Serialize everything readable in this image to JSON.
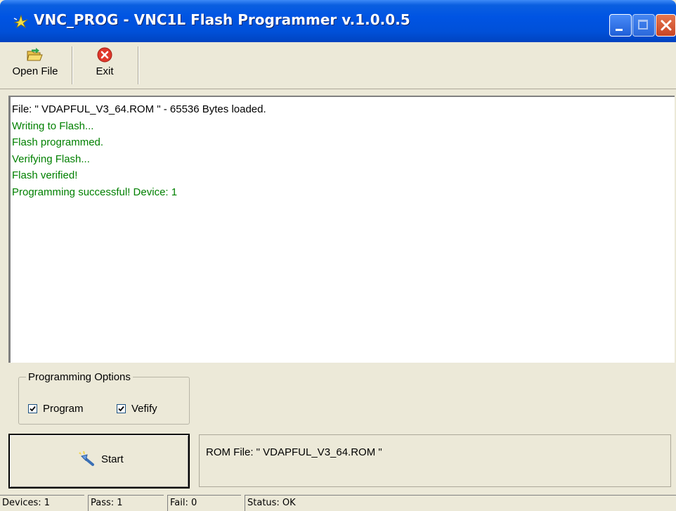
{
  "window": {
    "title": "VNC_PROG - VNC1L Flash Programmer v.1.0.0.5",
    "icons": {
      "app": "sparkle-icon",
      "minimize": "minimize-icon",
      "maximize": "maximize-icon",
      "close": "close-icon"
    }
  },
  "toolbar": {
    "open_file": {
      "label": "Open File",
      "icon": "folder-open-icon"
    },
    "exit": {
      "label": "Exit",
      "icon": "error-circle-icon"
    }
  },
  "log": {
    "lines": [
      {
        "text": "File: \" VDAPFUL_V3_64.ROM \" - 65536 Bytes loaded.",
        "color": "#000000"
      },
      {
        "text": "Writing to Flash...",
        "color": "#008000"
      },
      {
        "text": "Flash programmed.",
        "color": "#008000"
      },
      {
        "text": "Verifying Flash...",
        "color": "#008000"
      },
      {
        "text": "Flash verified!",
        "color": "#008000"
      },
      {
        "text": "Programming successful! Device: 1",
        "color": "#008000"
      }
    ]
  },
  "options": {
    "legend": "Programming Options",
    "program": {
      "label": "Program",
      "checked": true
    },
    "verify": {
      "label": "Vefify",
      "checked": true
    }
  },
  "start": {
    "label": "Start",
    "icon": "wand-icon"
  },
  "rom_panel": {
    "text": "ROM File: \" VDAPFUL_V3_64.ROM \""
  },
  "status": {
    "devices": "Devices: 1",
    "pass": "Pass: 1",
    "fail": "Fail: 0",
    "status": "Status: OK"
  },
  "colors": {
    "title_blue": "#0054e3",
    "log_green": "#008000",
    "close_red": "#d95a36",
    "face": "#ece9d8"
  }
}
